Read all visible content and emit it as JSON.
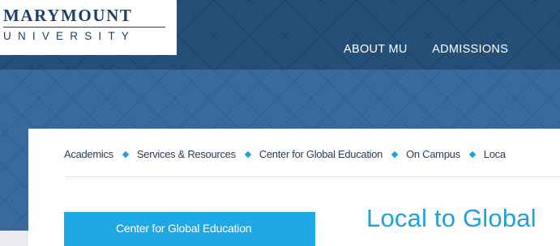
{
  "brand": {
    "name": "MARYMOUNT",
    "subname": "UNIVERSITY"
  },
  "nav": {
    "items": [
      "ABOUT MU",
      "ADMISSIONS"
    ]
  },
  "breadcrumb": {
    "items": [
      "Academics",
      "Services & Resources",
      "Center for Global Education",
      "On Campus",
      "Loca"
    ]
  },
  "sidebar": {
    "heading": "Center for Global Education"
  },
  "page": {
    "title": "Local to Global"
  },
  "colors": {
    "header_navy": "#264f78",
    "hero_blue": "#3a6a9d",
    "accent_cyan": "#1ea8e4",
    "logo_navy": "#1e3f66"
  }
}
